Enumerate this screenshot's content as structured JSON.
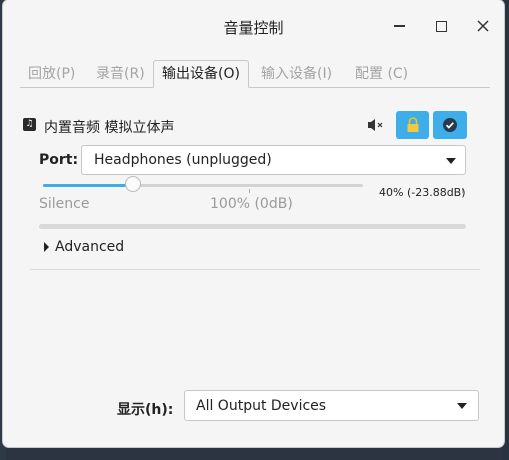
{
  "window": {
    "title": "音量控制"
  },
  "tabs": [
    {
      "label": "回放(P)"
    },
    {
      "label": "录音(R)"
    },
    {
      "label": "输出设备(O)"
    },
    {
      "label": "输入设备(I)"
    },
    {
      "label": "配置 (C)"
    }
  ],
  "active_tab": "输出设备(O)",
  "device": {
    "name": "内置音频 模拟立体声",
    "port_label": "Port:",
    "port_value": "Headphones (unplugged)",
    "volume_text": "40% (-23.88dB)",
    "volume_fraction": 0.28,
    "scale_silence": "Silence",
    "scale_100": "100% (0dB)",
    "advanced_label": "Advanced",
    "lock_enabled": true,
    "default_set": true
  },
  "footer": {
    "show_label": "显示(h):",
    "show_value": "All Output Devices"
  },
  "colors": {
    "accent": "#3daee9"
  }
}
